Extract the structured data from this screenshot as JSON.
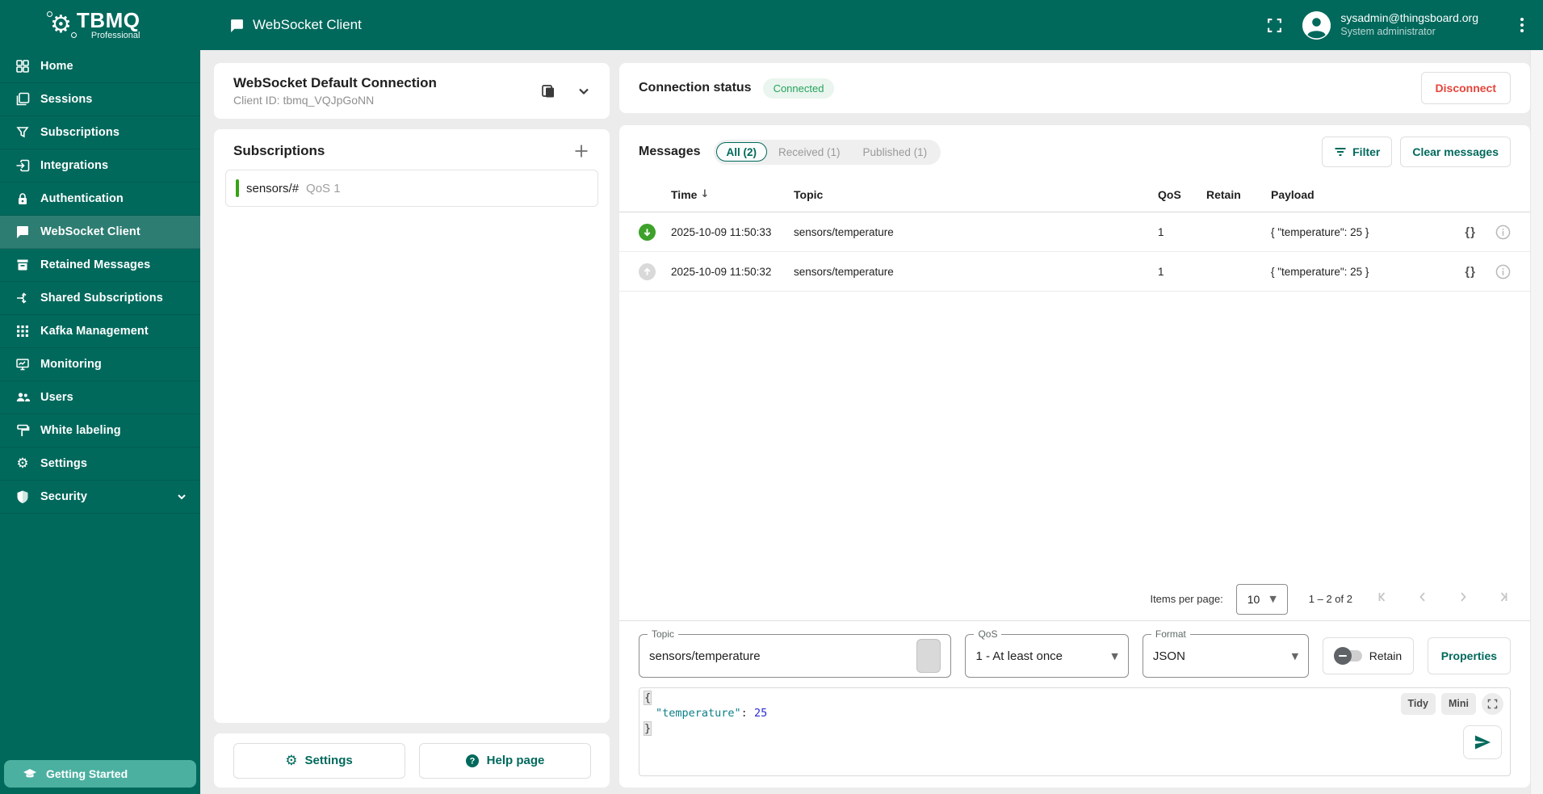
{
  "colors": {
    "accent": "#00695c",
    "header_teal": "#00695c",
    "connected_green": "#27a35d",
    "disconnect_red": "#e5453b",
    "received_green": "#3da12a",
    "published_gray": "#d9d9d9",
    "subscription_green": "#36a413"
  },
  "header": {
    "logo_title": "TBMQ",
    "logo_subtitle": "Professional",
    "page_title": "WebSocket Client",
    "user_email": "sysadmin@thingsboard.org",
    "user_role": "System administrator"
  },
  "sidebar": {
    "items": [
      {
        "label": "Home",
        "icon": "dashboard-icon"
      },
      {
        "label": "Sessions",
        "icon": "sessions-icon"
      },
      {
        "label": "Subscriptions",
        "icon": "funnel-icon"
      },
      {
        "label": "Integrations",
        "icon": "input-icon"
      },
      {
        "label": "Authentication",
        "icon": "lock-icon"
      },
      {
        "label": "WebSocket Client",
        "icon": "chat-icon",
        "active": true
      },
      {
        "label": "Retained Messages",
        "icon": "archive-icon"
      },
      {
        "label": "Shared Subscriptions",
        "icon": "split-icon"
      },
      {
        "label": "Kafka Management",
        "icon": "apps-grid-icon"
      },
      {
        "label": "Monitoring",
        "icon": "monitor-icon"
      },
      {
        "label": "Users",
        "icon": "people-icon"
      },
      {
        "label": "White labeling",
        "icon": "paint-icon"
      },
      {
        "label": "Settings",
        "icon": "gear-icon"
      },
      {
        "label": "Security",
        "icon": "shield-icon",
        "expandable": true
      }
    ],
    "getting_started": "Getting Started"
  },
  "connection": {
    "title": "WebSocket Default Connection",
    "client_id": "Client ID: tbmq_VQJpGoNN"
  },
  "subscriptions": {
    "title": "Subscriptions",
    "items": [
      {
        "topic": "sensors/#",
        "qos": "QoS 1"
      }
    ]
  },
  "left_footer": {
    "settings": "Settings",
    "help": "Help page"
  },
  "status": {
    "title": "Connection status",
    "badge": "Connected",
    "disconnect": "Disconnect"
  },
  "messages": {
    "title": "Messages",
    "tabs": [
      {
        "label": "All (2)",
        "active": true
      },
      {
        "label": "Received (1)",
        "active": false
      },
      {
        "label": "Published (1)",
        "active": false
      }
    ],
    "filter": "Filter",
    "clear": "Clear messages",
    "columns": [
      "Time",
      "Topic",
      "QoS",
      "Retain",
      "Payload"
    ],
    "rows": [
      {
        "direction": "received",
        "time": "2025-10-09 11:50:33",
        "topic": "sensors/temperature",
        "qos": "1",
        "retain": "",
        "payload": "{ \"temperature\": 25 }"
      },
      {
        "direction": "published",
        "time": "2025-10-09 11:50:32",
        "topic": "sensors/temperature",
        "qos": "1",
        "retain": "",
        "payload": "{ \"temperature\": 25 }"
      }
    ],
    "pagination": {
      "label": "Items per page:",
      "per_page": "10",
      "range": "1 – 2 of 2"
    }
  },
  "publish": {
    "topic_label": "Topic",
    "topic_value": "sensors/temperature",
    "qos_label": "QoS",
    "qos_value": "1 - At least once",
    "format_label": "Format",
    "format_value": "JSON",
    "retain_label": "Retain",
    "properties_label": "Properties"
  },
  "editor": {
    "tidy": "Tidy",
    "mini": "Mini",
    "open_brace": "{",
    "key": "\"temperature\"",
    "colon": ":",
    "value": "25",
    "close_brace": "}"
  }
}
